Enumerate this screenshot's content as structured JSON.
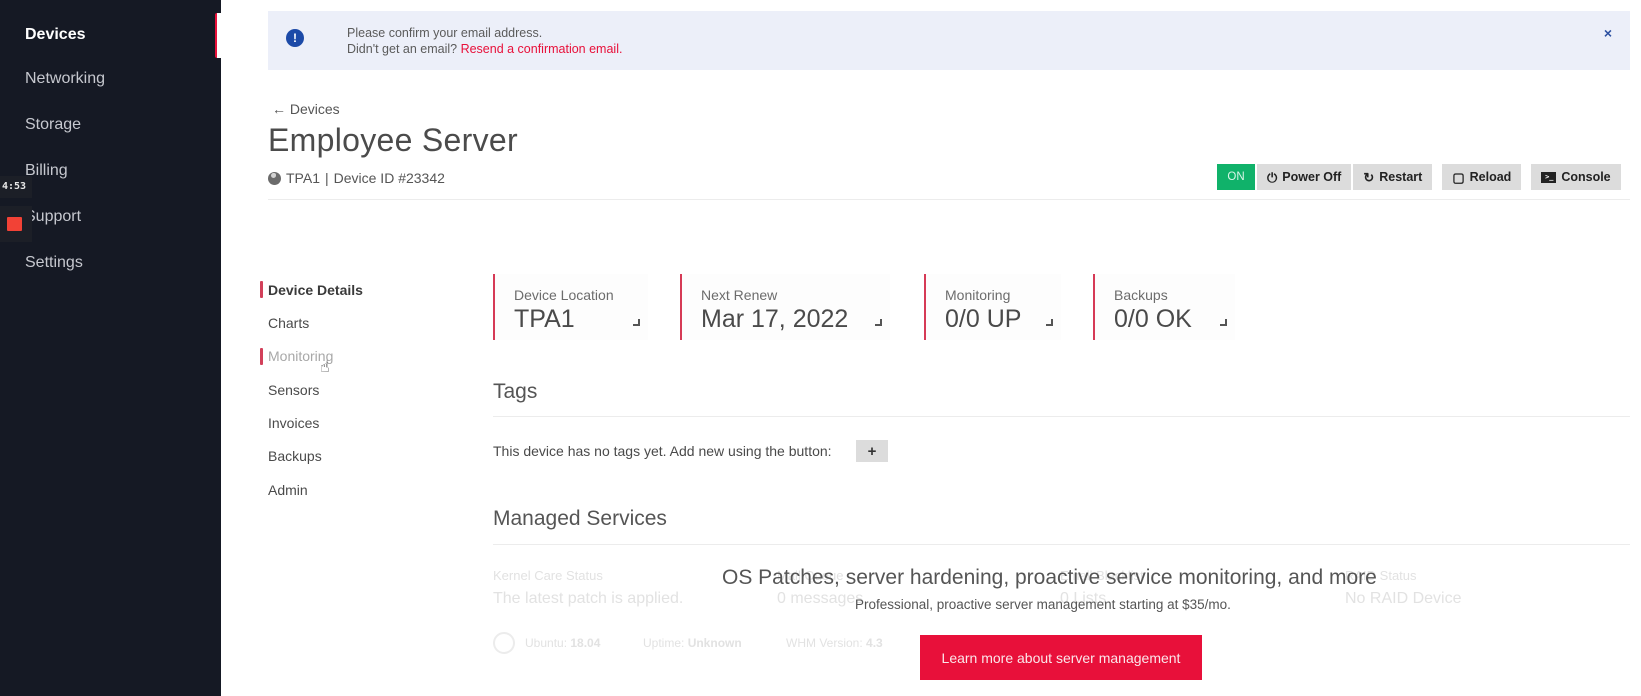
{
  "sidebar": {
    "items": [
      {
        "label": "Devices",
        "active": true
      },
      {
        "label": "Networking"
      },
      {
        "label": "Storage"
      },
      {
        "label": "Billing"
      },
      {
        "label": "Support"
      },
      {
        "label": "Settings"
      }
    ]
  },
  "overlay": {
    "timer": "4:53",
    "record_icon": "record-icon"
  },
  "alert": {
    "icon": "exclamation-icon",
    "line1": "Please confirm your email address.",
    "line2_prefix": "Didn't get an email? ",
    "link": "Resend a confirmation email.",
    "close": "×"
  },
  "header": {
    "back_label": "← Devices",
    "title": "Employee Server",
    "location": "TPA1",
    "separator": "|",
    "device_id": "Device ID #23342"
  },
  "actions": {
    "status": "ON",
    "power_off": "Power Off",
    "restart": "Restart",
    "reload": "Reload",
    "console": "Console",
    "icons": {
      "power_off": "⏻",
      "restart": "↻",
      "reload": "🔓",
      "console": ">_"
    }
  },
  "subnav": {
    "items": [
      {
        "label": "Device Details",
        "active": true
      },
      {
        "label": "Charts"
      },
      {
        "label": "Monitoring",
        "hover": true
      },
      {
        "label": "Sensors"
      },
      {
        "label": "Invoices"
      },
      {
        "label": "Backups"
      },
      {
        "label": "Admin"
      }
    ]
  },
  "cards": [
    {
      "label": "Device Location",
      "value": "TPA1"
    },
    {
      "label": "Next Renew",
      "value": "Mar 17, 2022"
    },
    {
      "label": "Monitoring",
      "value": "0/0 UP"
    },
    {
      "label": "Backups",
      "value": "0/0 OK"
    }
  ],
  "tags": {
    "title": "Tags",
    "empty_text": "This device has no tags yet. Add new using the button:",
    "add_label": "+"
  },
  "managed_services": {
    "title": "Managed Services",
    "faded_items": [
      {
        "label": "Kernel Care Status",
        "value": "The latest patch is applied."
      },
      {
        "label": "Mail Queue",
        "value": "0 messages"
      },
      {
        "label": "Email Blacklist",
        "value": "0 Lists"
      },
      {
        "label": "RAID Status",
        "value": "No RAID Device"
      }
    ],
    "faded_footer": {
      "os_label": "Ubuntu:",
      "os_value": "18.04",
      "uptime_label": "Uptime:",
      "uptime_value": "Unknown",
      "whm_label": "WHM Version:",
      "whm_value": "4.3"
    },
    "promo_title": "OS Patches, server hardening, proactive service monitoring, and more",
    "promo_subtitle": "Professional, proactive server management starting at $35/mo.",
    "promo_button": "Learn more about server management"
  }
}
